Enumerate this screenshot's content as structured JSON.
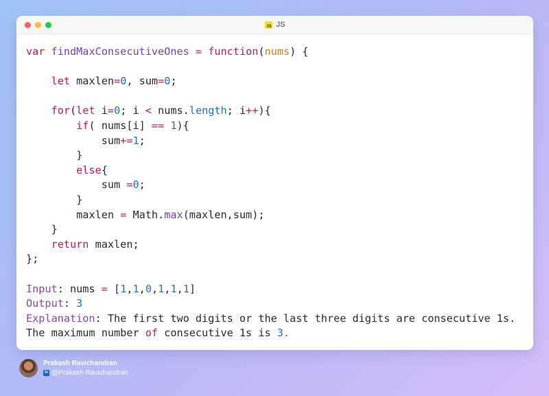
{
  "window": {
    "tab_label": "JS",
    "js_icon_text": "JS"
  },
  "code_lines": [
    [
      [
        "kw",
        "var"
      ],
      [
        "t",
        " "
      ],
      [
        "fn",
        "findMaxConsecutiveOnes"
      ],
      [
        "t",
        " "
      ],
      [
        "op",
        "="
      ],
      [
        "t",
        " "
      ],
      [
        "kw",
        "function"
      ],
      [
        "t",
        "("
      ],
      [
        "par",
        "nums"
      ],
      [
        "t",
        ") {"
      ]
    ],
    [],
    [
      [
        "t",
        "    "
      ],
      [
        "kw",
        "let"
      ],
      [
        "t",
        " maxlen"
      ],
      [
        "op",
        "="
      ],
      [
        "num",
        "0"
      ],
      [
        "t",
        ", sum"
      ],
      [
        "op",
        "="
      ],
      [
        "num",
        "0"
      ],
      [
        "t",
        ";"
      ]
    ],
    [],
    [
      [
        "t",
        "    "
      ],
      [
        "kw",
        "for"
      ],
      [
        "t",
        "("
      ],
      [
        "kw",
        "let"
      ],
      [
        "t",
        " i"
      ],
      [
        "op",
        "="
      ],
      [
        "num",
        "0"
      ],
      [
        "t",
        "; i "
      ],
      [
        "op",
        "<"
      ],
      [
        "t",
        " nums."
      ],
      [
        "prop",
        "length"
      ],
      [
        "t",
        "; i"
      ],
      [
        "op",
        "++"
      ],
      [
        "t",
        "){"
      ]
    ],
    [
      [
        "t",
        "        "
      ],
      [
        "kw",
        "if"
      ],
      [
        "t",
        "( nums[i] "
      ],
      [
        "op",
        "=="
      ],
      [
        "t",
        " "
      ],
      [
        "num",
        "1"
      ],
      [
        "t",
        "){"
      ]
    ],
    [
      [
        "t",
        "            sum"
      ],
      [
        "op",
        "+="
      ],
      [
        "num",
        "1"
      ],
      [
        "t",
        ";"
      ]
    ],
    [
      [
        "t",
        "        }"
      ]
    ],
    [
      [
        "t",
        "        "
      ],
      [
        "kw",
        "else"
      ],
      [
        "t",
        "{"
      ]
    ],
    [
      [
        "t",
        "            sum "
      ],
      [
        "op",
        "="
      ],
      [
        "num",
        "0"
      ],
      [
        "t",
        ";"
      ]
    ],
    [
      [
        "t",
        "        }"
      ]
    ],
    [
      [
        "t",
        "        maxlen "
      ],
      [
        "op",
        "="
      ],
      [
        "t",
        " Math."
      ],
      [
        "fn",
        "max"
      ],
      [
        "t",
        "(maxlen,sum);"
      ]
    ],
    [
      [
        "t",
        "    }"
      ]
    ],
    [
      [
        "t",
        "    "
      ],
      [
        "kw",
        "return"
      ],
      [
        "t",
        " maxlen;"
      ]
    ],
    [
      [
        "t",
        "};"
      ]
    ],
    [],
    [
      [
        "kwp",
        "Input"
      ],
      [
        "t",
        ": nums "
      ],
      [
        "op",
        "="
      ],
      [
        "t",
        " ["
      ],
      [
        "num",
        "1"
      ],
      [
        "t",
        ","
      ],
      [
        "num",
        "1"
      ],
      [
        "t",
        ","
      ],
      [
        "num",
        "0"
      ],
      [
        "t",
        ","
      ],
      [
        "num",
        "1"
      ],
      [
        "t",
        ","
      ],
      [
        "num",
        "1"
      ],
      [
        "t",
        ","
      ],
      [
        "num",
        "1"
      ],
      [
        "t",
        "]"
      ]
    ],
    [
      [
        "kwp",
        "Output"
      ],
      [
        "t",
        ": "
      ],
      [
        "num",
        "3"
      ]
    ],
    [
      [
        "kwp",
        "Explanation"
      ],
      [
        "t",
        ": The first two digits or the last three digits are consecutive 1s."
      ]
    ],
    [
      [
        "t",
        "The maximum number "
      ],
      [
        "kw",
        "of"
      ],
      [
        "t",
        " consecutive 1s is "
      ],
      [
        "num",
        "3."
      ]
    ]
  ],
  "author": {
    "name": "Prakash Ravichandran",
    "handle": "@Prakash Ravichandran",
    "linkedin_icon_text": "in"
  },
  "colors": {
    "keyword": "#c2185b",
    "number": "#1e73c8",
    "function": "#7b3fb5",
    "param": "#e07b00"
  }
}
